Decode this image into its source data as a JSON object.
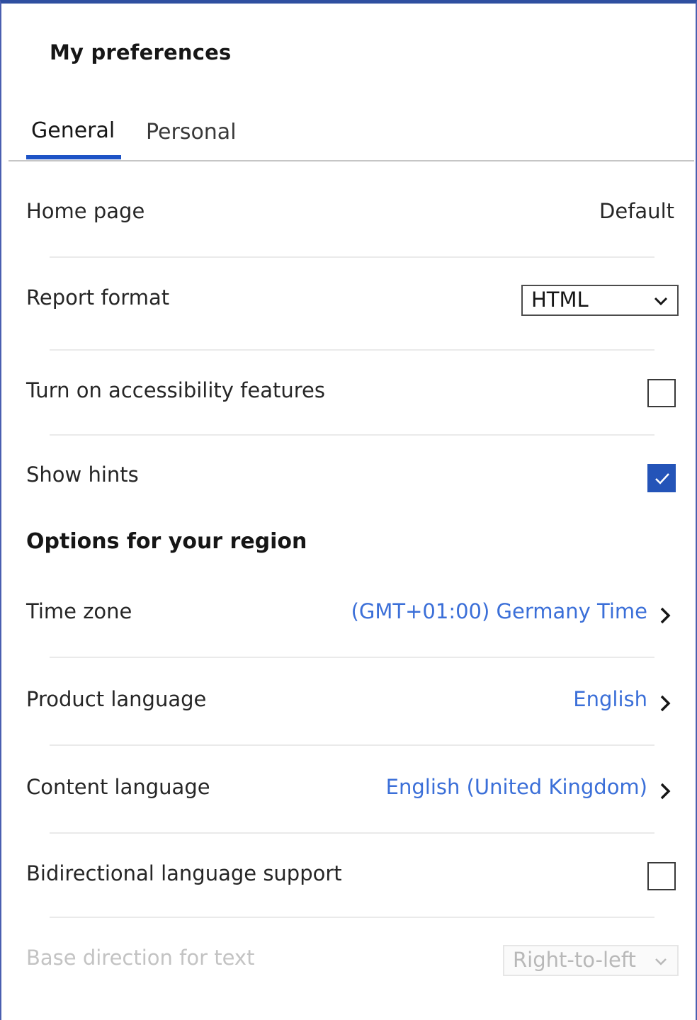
{
  "panel": {
    "title": "My preferences"
  },
  "tabs": [
    {
      "label": "General",
      "active": true
    },
    {
      "label": "Personal",
      "active": false
    }
  ],
  "general": {
    "home_page": {
      "label": "Home page",
      "value": "Default"
    },
    "report_format": {
      "label": "Report format",
      "value": "HTML"
    },
    "accessibility": {
      "label": "Turn on accessibility features",
      "checked": false
    },
    "show_hints": {
      "label": "Show hints",
      "checked": true
    }
  },
  "region": {
    "heading": "Options for your region",
    "time_zone": {
      "label": "Time zone",
      "value": "(GMT+01:00) Germany Time"
    },
    "product_language": {
      "label": "Product language",
      "value": "English"
    },
    "content_language": {
      "label": "Content language",
      "value": "English (United Kingdom)"
    },
    "bidi_support": {
      "label": "Bidirectional language support",
      "checked": false
    },
    "base_direction": {
      "label": "Base direction for text",
      "value": "Right-to-left",
      "disabled": true
    }
  },
  "colors": {
    "accent": "#2454b8",
    "link": "#3b6fd8",
    "tab_indicator": "#1d53c6",
    "border_top": "#2f4fa0"
  }
}
